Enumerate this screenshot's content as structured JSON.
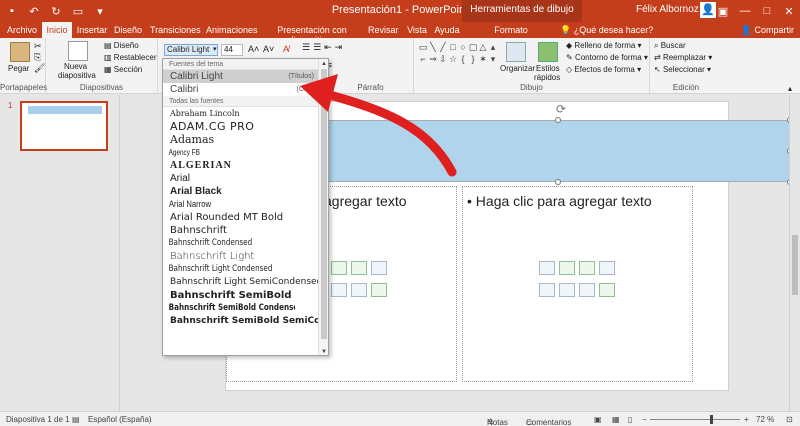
{
  "titlebar": {
    "title": "Presentación1 - PowerPoint",
    "context_tab": "Herramientas de dibujo",
    "user": "Félix Albornoz"
  },
  "tabs": [
    "Archivo",
    "Inicio",
    "Insertar",
    "Diseño",
    "Transiciones",
    "Animaciones",
    "Presentación con diapositivas",
    "Revisar",
    "Vista",
    "Ayuda",
    "Formato"
  ],
  "tell_me": "¿Qué desea hacer?",
  "share": "Compartir",
  "ribbon": {
    "pegar": "Pegar",
    "nueva": "Nueva",
    "diapositiva": "diapositiva",
    "diseno": "Diseño",
    "restablecer": "Restablecer",
    "seccion": "Sección",
    "font_name": "Calibri Light",
    "font_size": "44",
    "organizar": "Organizar",
    "estilos": "Estilos",
    "rapidos": "rápidos",
    "relleno": "Relleno de forma",
    "contorno": "Contorno de forma",
    "efectos": "Efectos de forma",
    "buscar": "Buscar",
    "reemplazar": "Reemplazar",
    "seleccionar": "Seleccionar",
    "groups": {
      "portapapeles": "Portapapeles",
      "diapositivas": "Diapositivas",
      "parrafo": "Párrafo",
      "dibujo": "Dibujo",
      "edicion": "Edición"
    }
  },
  "dropdown": {
    "theme_header": "Fuentes del tema",
    "all_header": "Todas las fuentes",
    "theme_fonts": [
      {
        "name": "Calibri Light",
        "tag": "(Títulos)"
      },
      {
        "name": "Calibri",
        "tag": "(Cuer"
      }
    ],
    "fonts": [
      "Abraham Lincoln",
      "ADAM.CG PRO",
      "Adamas",
      "Agency FB",
      "ALGERIAN",
      "Arial",
      "Arial Black",
      "Arial Narrow",
      "Arial Rounded MT Bold",
      "Bahnschrift",
      "Bahnschrift Condensed",
      "Bahnschrift Light",
      "Bahnschrift Light Condensed",
      "Bahnschrift Light SemiCondensed",
      "Bahnschrift SemiBold",
      "Bahnschrift SemiBold Condensed",
      "Bahnschrift SemiBold SemiConden"
    ]
  },
  "slide": {
    "number": "1",
    "left_text": "agregar texto",
    "right_text": "• Haga clic para agregar texto"
  },
  "status": {
    "slide_count": "Diapositiva 1 de 1",
    "language": "Español (España)",
    "notes": "Notas",
    "comments": "Comentarios",
    "zoom": "72 %"
  },
  "colors": {
    "accent": "#c43e1c",
    "title_fill": "#afd4eb",
    "arrow": "#e0201f"
  }
}
